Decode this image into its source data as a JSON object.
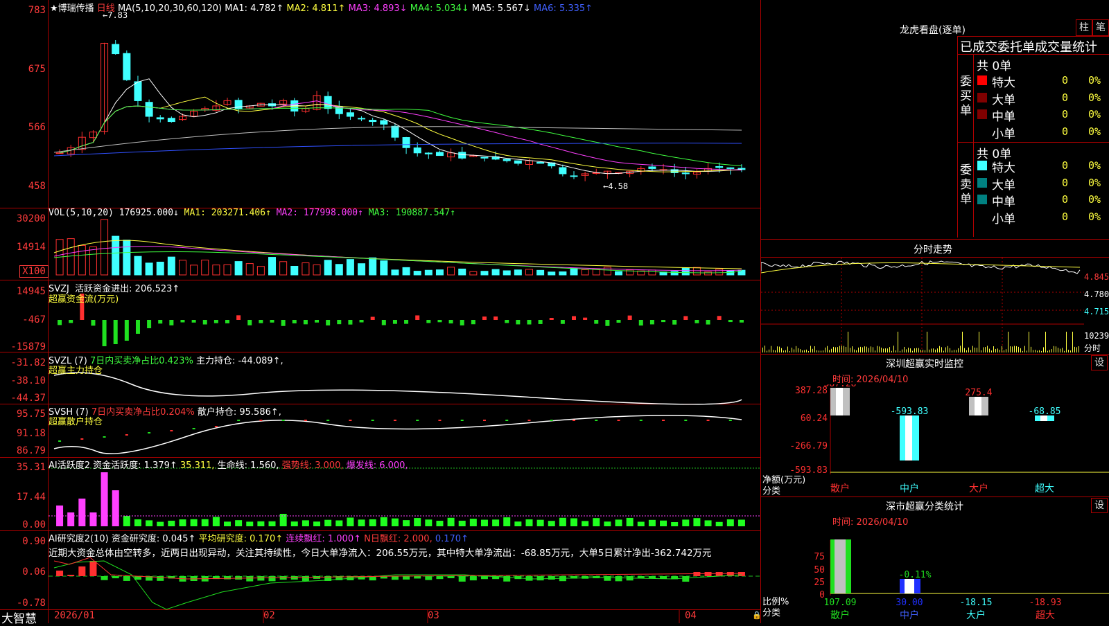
{
  "header": {
    "title": "★博瑞传播",
    "period": "日线",
    "ma_params": "MA(5,10,20,30,60,120)",
    "ma1": "MA1: 4.782↑",
    "ma2": "MA2: 4.811↑",
    "ma3": "MA3: 4.893↓",
    "ma4": "MA4: 5.034↓",
    "ma5": "MA5: 5.567↓",
    "ma6": "MA6: 5.335↑",
    "high_mark": "7.83",
    "low_mark": "4.58"
  },
  "price_axis": [
    "783",
    "675",
    "566",
    "458"
  ],
  "vol": {
    "label": "VOL(5,10,20)",
    "value": "176925.000↓",
    "ma1": "MA1: 203271.406↑",
    "ma2": "MA2: 177998.000↑",
    "ma3": "MA3: 190887.547↑",
    "axis": [
      "30200",
      "14914",
      "X100"
    ]
  },
  "svzj": {
    "label": "SVZJ",
    "text1": "活跃资金进出: 206.523↑",
    "text2": "超赢资金流(万元)",
    "axis": [
      "14945",
      "-467",
      "-15879"
    ]
  },
  "svzl": {
    "label": "SVZL  (7)",
    "text1": "7日内买卖净占比0.423%",
    "text2": "主力持仓: -44.089↑,",
    "text3": "超赢主力持仓",
    "axis": [
      "-31.82",
      "-38.10",
      "-44.37"
    ]
  },
  "svsh": {
    "label": "SVSH  (7)",
    "text1": "7日内买卖净占比0.204%",
    "text2": "散户持仓: 95.586↑,",
    "text3": "超赢散户持仓",
    "axis": [
      "95.75",
      "91.18",
      "86.79"
    ]
  },
  "ai_active": {
    "label": "AI活跃度2",
    "t1": "资金活跃度: 1.379↑",
    "t2": "35.311,",
    "t3": "生命线: 1.560,",
    "t4": "强势线: 3.000,",
    "t5": "爆发线: 6.000,",
    "axis": [
      "35.31",
      "17.44",
      "0.00"
    ]
  },
  "ai_research": {
    "label": "AI研究度2(10)",
    "t1": "资金研究度: 0.045↑",
    "t2": "平均研究度: 0.170↑",
    "t3": "连续飘红: 1.000↑",
    "t4": "N日飘红: 2.000,",
    "t5": "0.170↑",
    "note": "近期大资金总体由空转多，近两日出现异动，关注其持续性，今日大单净流入：206.55万元，其中特大单净流出：-68.85万元，大单5日累计净出-362.742万元",
    "axis": [
      "0.90",
      "0.06",
      "-0.78"
    ]
  },
  "date_axis": [
    "2026/01",
    "02",
    "03",
    "04"
  ],
  "brand": "大智慧",
  "right": {
    "title": "龙虎看盘(逐单)",
    "btn1": "柱",
    "btn2": "笔",
    "sub_title": "已成交委托单成交量统计",
    "buy": {
      "side": "委买单",
      "total": "共 0单",
      "rows": [
        {
          "name": "特大",
          "count": "0",
          "pct": "0%",
          "color": "#ff0000"
        },
        {
          "name": "大单",
          "count": "0",
          "pct": "0%",
          "color": "#800000"
        },
        {
          "name": "中单",
          "count": "0",
          "pct": "0%",
          "color": "#800000"
        },
        {
          "name": "小单",
          "count": "0",
          "pct": "0%",
          "color": ""
        }
      ]
    },
    "sell": {
      "side": "委卖单",
      "total": "共 0单",
      "rows": [
        {
          "name": "特大",
          "count": "0",
          "pct": "0%",
          "color": "#40ffff"
        },
        {
          "name": "大单",
          "count": "0",
          "pct": "0%",
          "color": "#008080"
        },
        {
          "name": "中单",
          "count": "0",
          "pct": "0%",
          "color": "#008080"
        },
        {
          "name": "小单",
          "count": "0",
          "pct": "0%",
          "color": ""
        }
      ]
    },
    "intraday": {
      "title": "分时走势",
      "axis": [
        "4.845",
        "4.780",
        "4.715",
        "10239",
        "分时"
      ]
    },
    "monitor": {
      "title": "深圳超赢实时监控",
      "btn": "设",
      "time": "时间: 2026/04/10",
      "axis": [
        "387.28",
        "60.24",
        "-266.79",
        "-593.83"
      ],
      "unit1": "净额(万元)",
      "unit2": "分类",
      "bars": [
        {
          "name": "散户",
          "value": "387.28"
        },
        {
          "name": "中户",
          "value": "-593.83"
        },
        {
          "name": "大户",
          "value": "275.4"
        },
        {
          "name": "超大",
          "value": "-68.85"
        }
      ]
    },
    "stats": {
      "title": "深市超赢分类统计",
      "btn": "设",
      "time": "时间: 2026/04/10",
      "axis": [
        "75",
        "50",
        "25",
        "0"
      ],
      "unit1": "比例%",
      "unit2": "分类",
      "bars": [
        {
          "name": "散户",
          "value": "107.09"
        },
        {
          "name": "中户",
          "value": "30.00"
        },
        {
          "name": "大户",
          "value": "-18.15"
        },
        {
          "name": "超大",
          "value": "-18.93"
        }
      ],
      "label_mid": "-0.11%"
    }
  }
}
